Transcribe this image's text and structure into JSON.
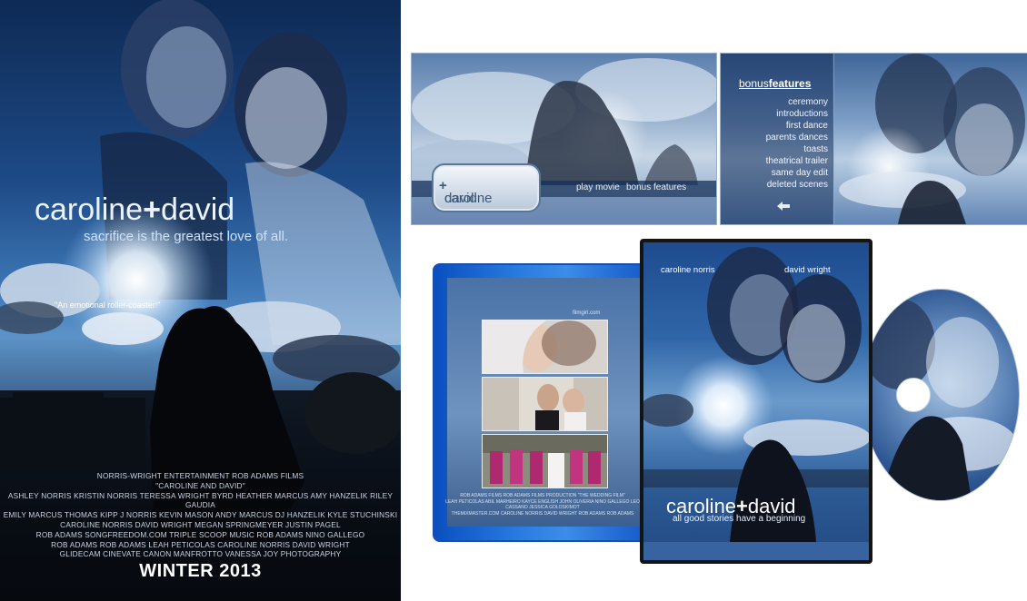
{
  "poster": {
    "title_left": "caroline",
    "title_plus": "+",
    "title_right": "david",
    "tagline": "sacrifice is the greatest love of all.",
    "credits": [
      "NORRIS-WRIGHT ENTERTAINMENT  ROB ADAMS FILMS",
      "\"CAROLINE AND DAVID\"",
      "ASHLEY NORRIS  KRISTIN NORRIS  TERESSA WRIGHT BYRD  HEATHER MARCUS  AMY HANZELIK  RILEY GAUDIA",
      "EMILY MARCUS  THOMAS KIPP  J NORRIS  KEVIN MASON  ANDY MARCUS  DJ HANZELIK  KYLE STUCHINSKI",
      "CAROLINE NORRIS  DAVID WRIGHT  MEGAN SPRINGMEYER  JUSTIN PAGEL",
      "ROB ADAMS  SONGFREEDOM.COM  TRIPLE SCOOP MUSIC  ROB ADAMS  NINO GALLEGO",
      "ROB ADAMS  ROB ADAMS  LEAH PETICOLAS  CAROLINE NORRIS  DAVID WRIGHT",
      "GLIDECAM  CINEVATE  CANON  MANFROTTO  VANESSA JOY PHOTOGRAPHY"
    ],
    "release": "WINTER 2013"
  },
  "menu_main": {
    "plaque_left": "caroline",
    "plaque_plus": "+",
    "plaque_right": "david",
    "play_movie": "play movie",
    "bonus_features": "bonus features"
  },
  "menu_bonus": {
    "heading_a": "bonus",
    "heading_b": "features",
    "items": [
      "ceremony",
      "introductions",
      "first dance",
      "parents dances",
      "toasts",
      "theatrical trailer",
      "same day edit",
      "deleted scenes"
    ],
    "back_icon": "left-arrow-icon"
  },
  "bluray": {
    "quote": "\"An emotional roller-coaster!\"",
    "quote_source": "filmgirl.com",
    "credits": [
      "ROB ADAMS FILMS  ROB ADAMS FILMS PRODUCTION \"THE WEDDING FILM\"",
      "LEAH PETICOLAS  ABIL MARHEIRO  KAYCE ENGLISH  JOHN OLIVERIA  NINO GALLEGO  LEO CASSANO  JESSICA GOLOSKIMOT",
      "THEMIXMASTER.COM  CAROLINE NORRIS  DAVID WRIGHT  ROB ADAMS  ROB ADAMS"
    ]
  },
  "dvd": {
    "name_left": "caroline norris",
    "name_right": "david wright",
    "title_left": "caroline",
    "title_plus": "+",
    "title_right": "david",
    "tagline": "all good stories have a beginning"
  },
  "colors": {
    "sky_blue": "#3d77b6",
    "bluray_case": "#2a7de0",
    "dvd_case": "#141414"
  }
}
